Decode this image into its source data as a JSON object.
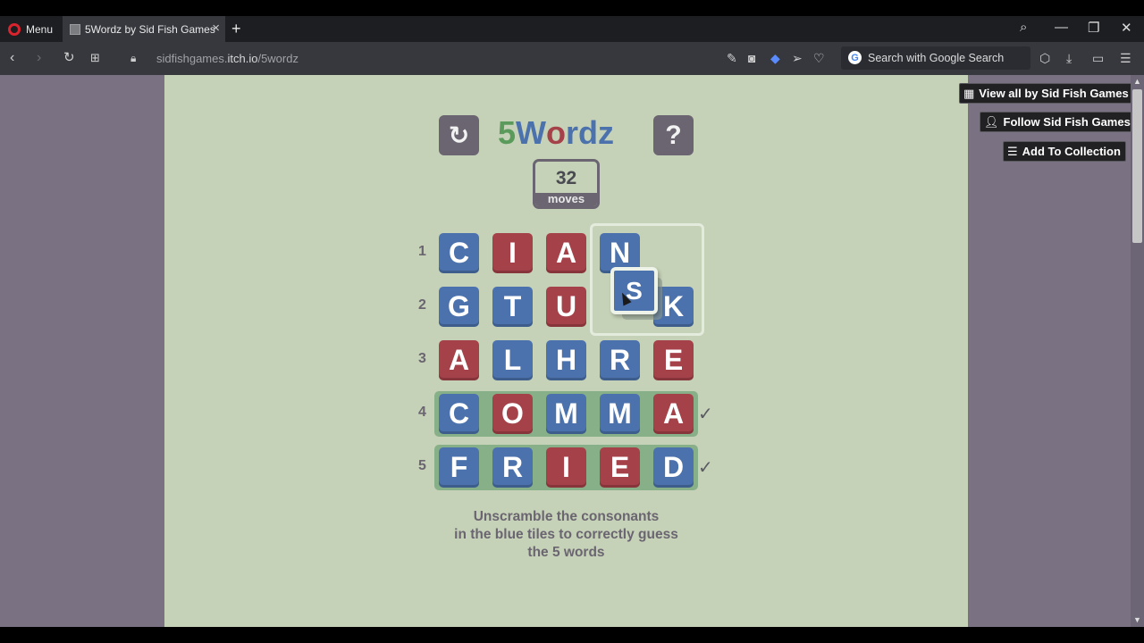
{
  "browser": {
    "menu_label": "Menu",
    "tab_title": "5Wordz by Sid Fish Games",
    "url_domain": "sidfishgames.",
    "url_host": "itch.io",
    "url_path": "/5wordz",
    "search_placeholder": "Search with Google Search"
  },
  "itch": {
    "view_all": "View all by Sid Fish Games",
    "follow": "Follow Sid Fish Games",
    "add_collection": "Add To Collection"
  },
  "game": {
    "title_letters": [
      {
        "ch": "5",
        "color": "#5a9a5a"
      },
      {
        "ch": "W",
        "color": "#4b72ad"
      },
      {
        "ch": "o",
        "color": "#a54149"
      },
      {
        "ch": "r",
        "color": "#4b72ad"
      },
      {
        "ch": "d",
        "color": "#4b72ad"
      },
      {
        "ch": "z",
        "color": "#4b72ad"
      }
    ],
    "restart_icon": "restart-icon",
    "help_label": "?",
    "moves_count": "32",
    "moves_label": "moves",
    "rows": [
      {
        "num": "1",
        "solved": false,
        "tiles": [
          {
            "l": "C",
            "c": "blue"
          },
          {
            "l": "I",
            "c": "red"
          },
          {
            "l": "A",
            "c": "red"
          },
          {
            "l": "N",
            "c": "blue"
          },
          null
        ]
      },
      {
        "num": "2",
        "solved": false,
        "tiles": [
          {
            "l": "G",
            "c": "blue"
          },
          {
            "l": "T",
            "c": "blue"
          },
          {
            "l": "U",
            "c": "red"
          },
          null,
          {
            "l": "K",
            "c": "blue"
          }
        ]
      },
      {
        "num": "3",
        "solved": false,
        "tiles": [
          {
            "l": "A",
            "c": "red"
          },
          {
            "l": "L",
            "c": "blue"
          },
          {
            "l": "H",
            "c": "blue"
          },
          {
            "l": "R",
            "c": "blue"
          },
          {
            "l": "E",
            "c": "red"
          }
        ]
      },
      {
        "num": "4",
        "solved": true,
        "tiles": [
          {
            "l": "C",
            "c": "blue"
          },
          {
            "l": "O",
            "c": "red"
          },
          {
            "l": "M",
            "c": "blue"
          },
          {
            "l": "M",
            "c": "blue"
          },
          {
            "l": "A",
            "c": "red"
          }
        ]
      },
      {
        "num": "5",
        "solved": true,
        "tiles": [
          {
            "l": "F",
            "c": "blue"
          },
          {
            "l": "R",
            "c": "blue"
          },
          {
            "l": "I",
            "c": "red"
          },
          {
            "l": "E",
            "c": "red"
          },
          {
            "l": "D",
            "c": "blue"
          }
        ]
      }
    ],
    "dragging_tile": "S",
    "check_mark": "✓",
    "instructions": [
      "Unscramble the consonants",
      "in the blue tiles to correctly guess",
      "the 5 words"
    ]
  }
}
